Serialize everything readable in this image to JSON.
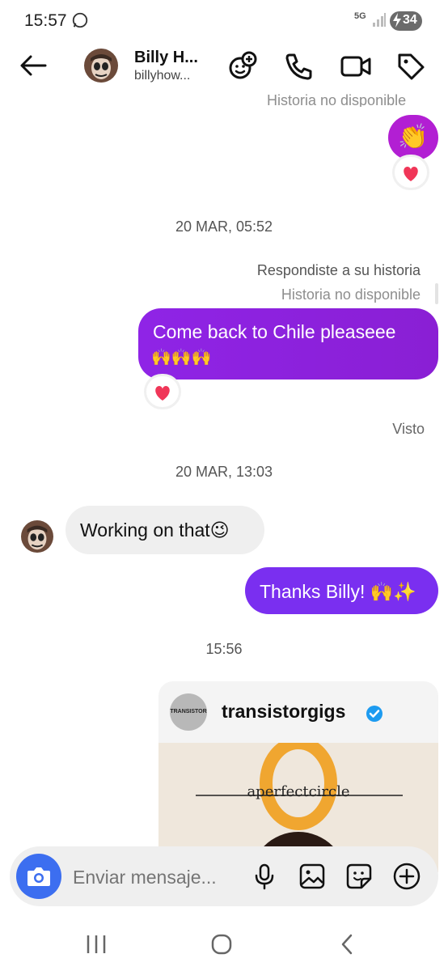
{
  "status": {
    "time": "15:57",
    "network": "5G",
    "battery": "34"
  },
  "header": {
    "name": "Billy H...",
    "username": "billyhow...",
    "icons": [
      "back-arrow-icon",
      "add-sticker-icon",
      "phone-icon",
      "video-call-icon",
      "tag-icon"
    ]
  },
  "messages": {
    "story_unavailable_top": "Historia no disponible",
    "ts1": "20 MAR, 05:52",
    "replied_story": "Respondiste a su historia",
    "story_unavailable": "Historia no disponible",
    "msg1": "Come back to Chile pleaseee",
    "msg1_emoji": "🙌🙌🙌",
    "seen": "Visto",
    "ts2": "20 MAR, 13:03",
    "incoming": "Working on that😉",
    "msg2": "Thanks Billy! 🙌✨",
    "ts3": "15:56"
  },
  "shared_post": {
    "logo_text": "TRANSISTOR",
    "handle": "transistorgigs",
    "verified": true,
    "band_text": "aperfectcircle"
  },
  "composer": {
    "placeholder": "Enviar mensaje..."
  },
  "colors": {
    "accent_purple": "#8a1fd4",
    "camera_blue": "#3c6ef0",
    "verified_blue": "#1d9bf0"
  }
}
